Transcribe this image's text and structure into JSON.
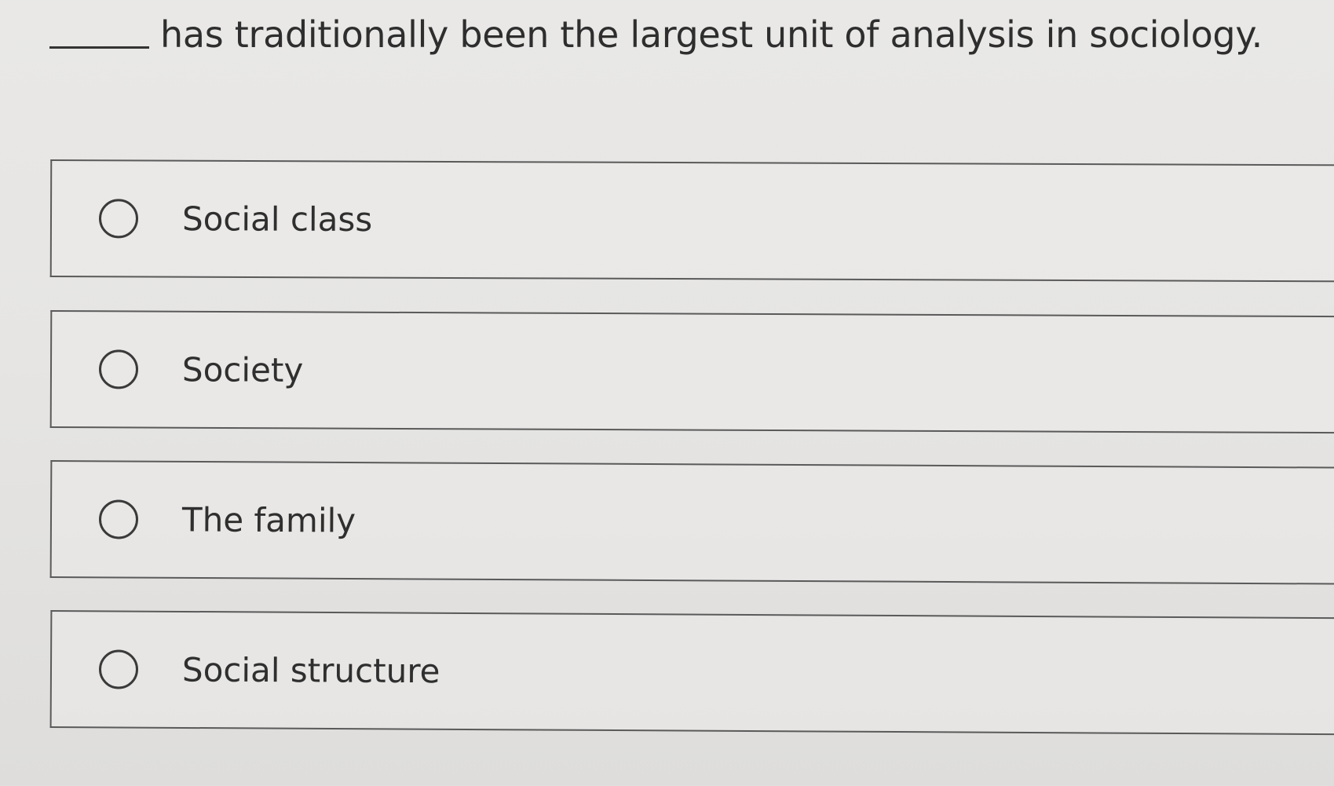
{
  "question": {
    "text": "has traditionally been the largest unit of analysis in sociology."
  },
  "options": [
    {
      "label": "Social class",
      "selected": false
    },
    {
      "label": "Society",
      "selected": false
    },
    {
      "label": "The family",
      "selected": false
    },
    {
      "label": "Social structure",
      "selected": false
    }
  ]
}
